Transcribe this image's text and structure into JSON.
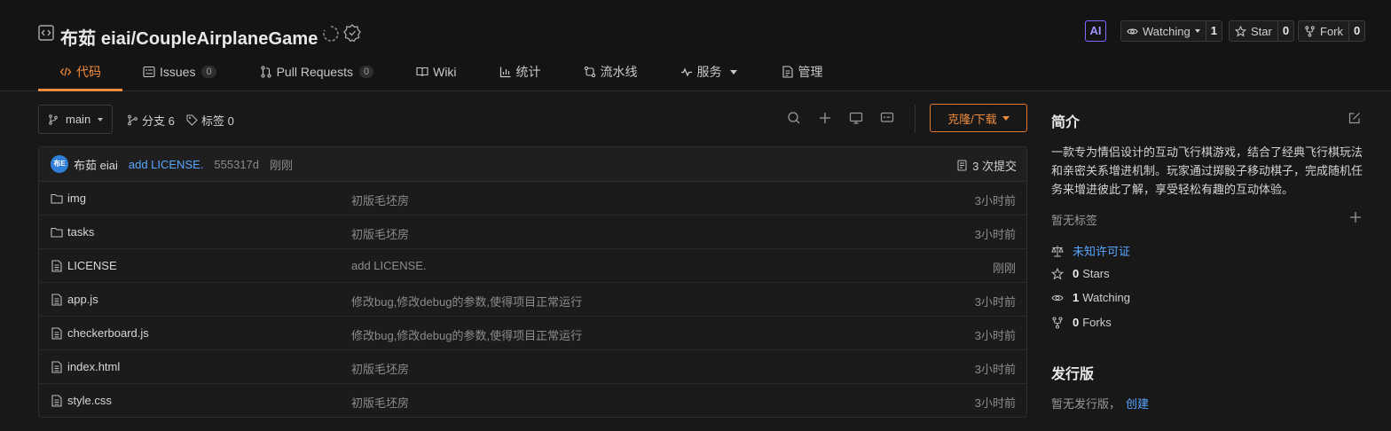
{
  "repo": {
    "title": "布茹 eiai/CoupleAirplaneGame"
  },
  "header_actions": {
    "ai_label": "AI",
    "watch_label": "Watching",
    "watch_count": "1",
    "star_label": "Star",
    "star_count": "0",
    "fork_label": "Fork",
    "fork_count": "0"
  },
  "tabs": [
    {
      "label": "代码",
      "icon": "code-icon",
      "active": true
    },
    {
      "label": "Issues",
      "count": "0",
      "icon": "issues-icon"
    },
    {
      "label": "Pull Requests",
      "count": "0",
      "icon": "pull-request-icon"
    },
    {
      "label": "Wiki",
      "icon": "wiki-icon"
    },
    {
      "label": "统计",
      "icon": "stats-icon"
    },
    {
      "label": "流水线",
      "icon": "pipeline-icon"
    },
    {
      "label": "服务",
      "icon": "service-icon"
    },
    {
      "label": "管理",
      "icon": "manage-icon"
    }
  ],
  "toolbar": {
    "branch": "main",
    "branches_label": "分支 6",
    "tags_label": "标签 0",
    "clone_label": "克隆/下载"
  },
  "commit": {
    "avatar_text": "布E",
    "author": "布茹 eiai",
    "message": "add LICENSE.",
    "hash": "555317d",
    "time": "刚刚",
    "count_label": "3 次提交"
  },
  "files": [
    {
      "type": "folder",
      "name": "img",
      "message": "初版毛坯房",
      "time": "3小时前"
    },
    {
      "type": "folder",
      "name": "tasks",
      "message": "初版毛坯房",
      "time": "3小时前"
    },
    {
      "type": "file",
      "name": "LICENSE",
      "message": "add LICENSE.",
      "time": "刚刚"
    },
    {
      "type": "file",
      "name": "app.js",
      "message": "修改bug,修改debug的参数,使得项目正常运行",
      "time": "3小时前"
    },
    {
      "type": "file",
      "name": "checkerboard.js",
      "message": "修改bug,修改debug的参数,使得项目正常运行",
      "time": "3小时前"
    },
    {
      "type": "file",
      "name": "index.html",
      "message": "初版毛坯房",
      "time": "3小时前"
    },
    {
      "type": "file",
      "name": "style.css",
      "message": "初版毛坯房",
      "time": "3小时前"
    }
  ],
  "sidebar": {
    "intro_title": "简介",
    "description": "一款专为情侣设计的互动飞行棋游戏，结合了经典飞行棋玩法和亲密关系增进机制。玩家通过掷骰子移动棋子，完成随机任务来增进彼此了解，享受轻松有趣的互动体验。",
    "no_tags": "暂无标签",
    "license": "未知许可证",
    "stars_count": "0",
    "stars_label": "Stars",
    "watching_count": "1",
    "watching_label": "Watching",
    "forks_count": "0",
    "forks_label": "Forks",
    "release_title": "发行版",
    "no_release": "暂无发行版，",
    "create_link": "创建"
  },
  "colors": {
    "accent": "#f08c3c",
    "link": "#58a6ff",
    "background": "#181818"
  }
}
